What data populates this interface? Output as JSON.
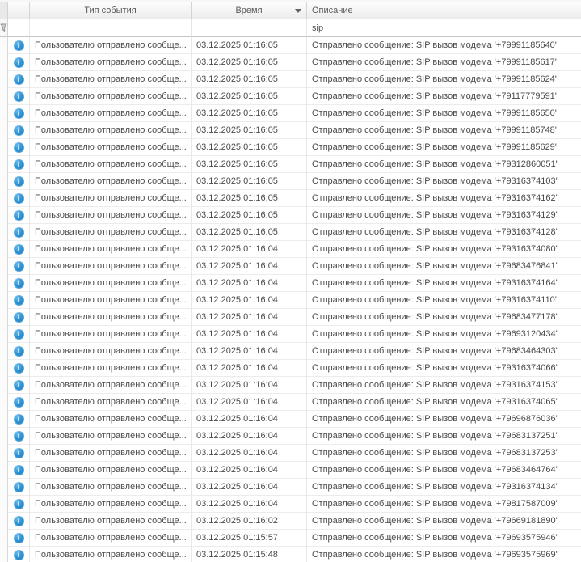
{
  "table": {
    "columns": {
      "type_label": "Тип события",
      "time_label": "Время",
      "desc_label": "Описание"
    },
    "sort": {
      "column": "Время",
      "direction": "desc"
    },
    "filter_row": {
      "desc_value": "sip"
    },
    "rows": [
      {
        "type": "Пользователю отправлено сообще...",
        "time": "03.12.2025 01:16:05",
        "desc": "Отправлено сообщение: SIP вызов модема '+79991185640'"
      },
      {
        "type": "Пользователю отправлено сообще...",
        "time": "03.12.2025 01:16:05",
        "desc": "Отправлено сообщение: SIP вызов модема '+79991185617'"
      },
      {
        "type": "Пользователю отправлено сообще...",
        "time": "03.12.2025 01:16:05",
        "desc": "Отправлено сообщение: SIP вызов модема '+79991185624'"
      },
      {
        "type": "Пользователю отправлено сообще...",
        "time": "03.12.2025 01:16:05",
        "desc": "Отправлено сообщение: SIP вызов модема '+79117779591'"
      },
      {
        "type": "Пользователю отправлено сообще...",
        "time": "03.12.2025 01:16:05",
        "desc": "Отправлено сообщение: SIP вызов модема '+79991185650'"
      },
      {
        "type": "Пользователю отправлено сообще...",
        "time": "03.12.2025 01:16:05",
        "desc": "Отправлено сообщение: SIP вызов модема '+79991185748'"
      },
      {
        "type": "Пользователю отправлено сообще...",
        "time": "03.12.2025 01:16:05",
        "desc": "Отправлено сообщение: SIP вызов модема '+79991185629'"
      },
      {
        "type": "Пользователю отправлено сообще...",
        "time": "03.12.2025 01:16:05",
        "desc": "Отправлено сообщение: SIP вызов модема '+79312860051'"
      },
      {
        "type": "Пользователю отправлено сообще...",
        "time": "03.12.2025 01:16:05",
        "desc": "Отправлено сообщение: SIP вызов модема '+79316374103'"
      },
      {
        "type": "Пользователю отправлено сообще...",
        "time": "03.12.2025 01:16:05",
        "desc": "Отправлено сообщение: SIP вызов модема '+79316374162'"
      },
      {
        "type": "Пользователю отправлено сообще...",
        "time": "03.12.2025 01:16:05",
        "desc": "Отправлено сообщение: SIP вызов модема '+79316374129'"
      },
      {
        "type": "Пользователю отправлено сообще...",
        "time": "03.12.2025 01:16:05",
        "desc": "Отправлено сообщение: SIP вызов модема '+79316374128'"
      },
      {
        "type": "Пользователю отправлено сообще...",
        "time": "03.12.2025 01:16:04",
        "desc": "Отправлено сообщение: SIP вызов модема '+79316374080'"
      },
      {
        "type": "Пользователю отправлено сообще...",
        "time": "03.12.2025 01:16:04",
        "desc": "Отправлено сообщение: SIP вызов модема '+79683476841'"
      },
      {
        "type": "Пользователю отправлено сообще...",
        "time": "03.12.2025 01:16:04",
        "desc": "Отправлено сообщение: SIP вызов модема '+79316374164'"
      },
      {
        "type": "Пользователю отправлено сообще...",
        "time": "03.12.2025 01:16:04",
        "desc": "Отправлено сообщение: SIP вызов модема '+79316374110'"
      },
      {
        "type": "Пользователю отправлено сообще...",
        "time": "03.12.2025 01:16:04",
        "desc": "Отправлено сообщение: SIP вызов модема '+79683477178'"
      },
      {
        "type": "Пользователю отправлено сообще...",
        "time": "03.12.2025 01:16:04",
        "desc": "Отправлено сообщение: SIP вызов модема '+79693120434'"
      },
      {
        "type": "Пользователю отправлено сообще...",
        "time": "03.12.2025 01:16:04",
        "desc": "Отправлено сообщение: SIP вызов модема '+79683464303'"
      },
      {
        "type": "Пользователю отправлено сообще...",
        "time": "03.12.2025 01:16:04",
        "desc": "Отправлено сообщение: SIP вызов модема '+79316374066'"
      },
      {
        "type": "Пользователю отправлено сообще...",
        "time": "03.12.2025 01:16:04",
        "desc": "Отправлено сообщение: SIP вызов модема '+79316374153'"
      },
      {
        "type": "Пользователю отправлено сообще...",
        "time": "03.12.2025 01:16:04",
        "desc": "Отправлено сообщение: SIP вызов модема '+79316374065'"
      },
      {
        "type": "Пользователю отправлено сообще...",
        "time": "03.12.2025 01:16:04",
        "desc": "Отправлено сообщение: SIP вызов модема '+79696876036'"
      },
      {
        "type": "Пользователю отправлено сообще...",
        "time": "03.12.2025 01:16:04",
        "desc": "Отправлено сообщение: SIP вызов модема '+79683137251'"
      },
      {
        "type": "Пользователю отправлено сообще...",
        "time": "03.12.2025 01:16:04",
        "desc": "Отправлено сообщение: SIP вызов модема '+79683137253'"
      },
      {
        "type": "Пользователю отправлено сообще...",
        "time": "03.12.2025 01:16:04",
        "desc": "Отправлено сообщение: SIP вызов модема '+79683464764'"
      },
      {
        "type": "Пользователю отправлено сообще...",
        "time": "03.12.2025 01:16:04",
        "desc": "Отправлено сообщение: SIP вызов модема '+79316374134'"
      },
      {
        "type": "Пользователю отправлено сообще...",
        "time": "03.12.2025 01:16:04",
        "desc": "Отправлено сообщение: SIP вызов модема '+79817587009'"
      },
      {
        "type": "Пользователю отправлено сообще...",
        "time": "03.12.2025 01:16:02",
        "desc": "Отправлено сообщение: SIP вызов модема '+79669181890'"
      },
      {
        "type": "Пользователю отправлено сообще...",
        "time": "03.12.2025 01:15:57",
        "desc": "Отправлено сообщение: SIP вызов модема '+79693575946'"
      },
      {
        "type": "Пользователю отправлено сообще...",
        "time": "03.12.2025 01:15:48",
        "desc": "Отправлено сообщение: SIP вызов модема '+79693575969'"
      }
    ]
  },
  "icons": {
    "info_glyph": "i",
    "info_name": "info-icon",
    "filter_name": "filter-funnel-icon",
    "sort_name": "sort-descending-arrow-icon"
  },
  "colors": {
    "info_icon_blue": "#2e93d4",
    "header_text": "#595959",
    "cell_text": "#4a4a4a",
    "header_border": "#c6c6c6",
    "grid_line": "#ececec"
  }
}
